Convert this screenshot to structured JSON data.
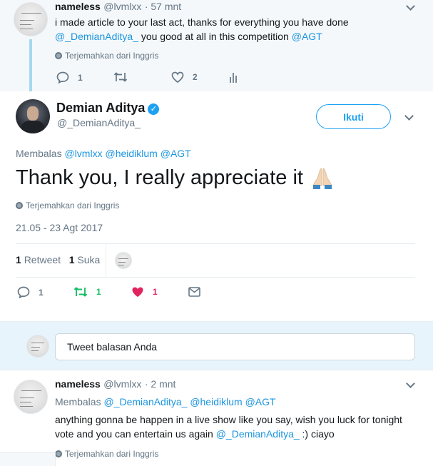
{
  "parent_tweet": {
    "name": "nameless",
    "handle": "@lvmlxx",
    "time": "· 57 mnt",
    "text_plain_1": "i made article to your last act, thanks for everything you have done",
    "mention_1": "@_DemianAditya_",
    "text_plain_2": " you good at all in this competition ",
    "mention_2": "@AGT",
    "translate": "Terjemahkan dari Inggris",
    "reply_count": "1",
    "like_count": "2"
  },
  "main_tweet": {
    "name": "Demian Aditya",
    "verified_glyph": "✓",
    "handle": "@_DemianAditya_",
    "follow_label": "Ikuti",
    "replying_label": "Membalas",
    "replying_to": [
      "@lvmlxx",
      "@heidiklum",
      "@AGT"
    ],
    "text": "Thank you, I really appreciate it",
    "translate": "Terjemahkan dari Inggris",
    "timestamp": "21.05 - 23 Agt 2017",
    "retweet_num": "1",
    "retweet_label": "Retweet",
    "like_num": "1",
    "like_label": "Suka",
    "reply_count": "1",
    "retweet_count": "1",
    "like_count": "1"
  },
  "reply_box": {
    "placeholder": "Tweet balasan Anda"
  },
  "reply_tweet": {
    "name": "nameless",
    "handle": "@lvmlxx",
    "time": "· 2 mnt",
    "replying_label": "Membalas",
    "replying_to": [
      "@_DemianAditya_",
      "@heidiklum",
      "@AGT"
    ],
    "text_line_1": "anything gonna be happen in a live show like you say, wish you luck for tonight",
    "text_line_2_plain": "vote and you can entertain us again ",
    "mention": "@_DemianAditya_",
    "text_line_2_tail": " :) ciayo",
    "translate": "Terjemahkan dari Inggris"
  },
  "colors": {
    "link": "#1b95e0",
    "like_active": "#e0245e",
    "retweet_active": "#17bf63",
    "muted": "#657786"
  }
}
